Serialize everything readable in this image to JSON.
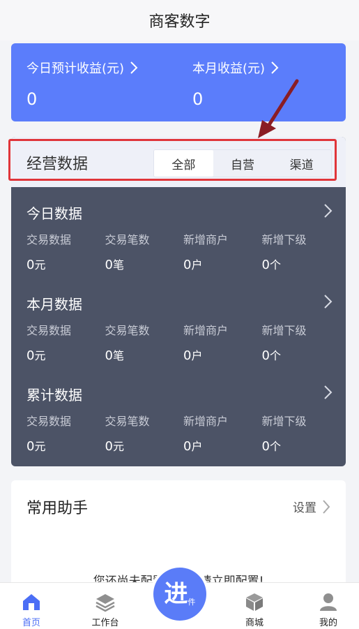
{
  "header": {
    "title": "商客数字"
  },
  "earnings": {
    "today_label": "今日预计收益(元)",
    "today_value": "0",
    "month_label": "本月收益(元)",
    "month_value": "0"
  },
  "operations": {
    "title": "经营数据",
    "tabs": [
      {
        "label": "全部",
        "active": true
      },
      {
        "label": "自营",
        "active": false
      },
      {
        "label": "渠道",
        "active": false
      }
    ],
    "blocks": [
      {
        "title": "今日数据",
        "labels": [
          "交易数据",
          "交易笔数",
          "新增商户",
          "新增下级"
        ],
        "values": [
          {
            "num": "0",
            "unit": "元"
          },
          {
            "num": "0",
            "unit": "笔"
          },
          {
            "num": "0",
            "unit": "户"
          },
          {
            "num": "0",
            "unit": "个"
          }
        ]
      },
      {
        "title": "本月数据",
        "labels": [
          "交易数据",
          "交易笔数",
          "新增商户",
          "新增下级"
        ],
        "values": [
          {
            "num": "0",
            "unit": "元"
          },
          {
            "num": "0",
            "unit": "笔"
          },
          {
            "num": "0",
            "unit": "户"
          },
          {
            "num": "0",
            "unit": "个"
          }
        ]
      },
      {
        "title": "累计数据",
        "labels": [
          "交易数据",
          "交易笔数",
          "新增商户",
          "新增下级"
        ],
        "values": [
          {
            "num": "0",
            "unit": "元"
          },
          {
            "num": "0",
            "unit": "元"
          },
          {
            "num": "0",
            "unit": "户"
          },
          {
            "num": "0",
            "unit": "个"
          }
        ]
      }
    ]
  },
  "helper": {
    "title": "常用助手",
    "settings_label": "设置",
    "empty_text": "您还尚未配置常用，请立即配置!"
  },
  "tabbar": {
    "items": [
      {
        "label": "首页",
        "icon": "home-icon",
        "active": true
      },
      {
        "label": "工作台",
        "icon": "layers-icon",
        "active": false
      },
      {
        "label": "商城",
        "icon": "box-icon",
        "active": false
      },
      {
        "label": "我的",
        "icon": "user-icon",
        "active": false
      }
    ],
    "fab": {
      "big": "进",
      "small": "件"
    }
  },
  "colors": {
    "primary": "#5b7dfb",
    "stats_bg": "#4c5366",
    "highlight": "#e0353a",
    "active_tab": "#4b6ef5"
  }
}
